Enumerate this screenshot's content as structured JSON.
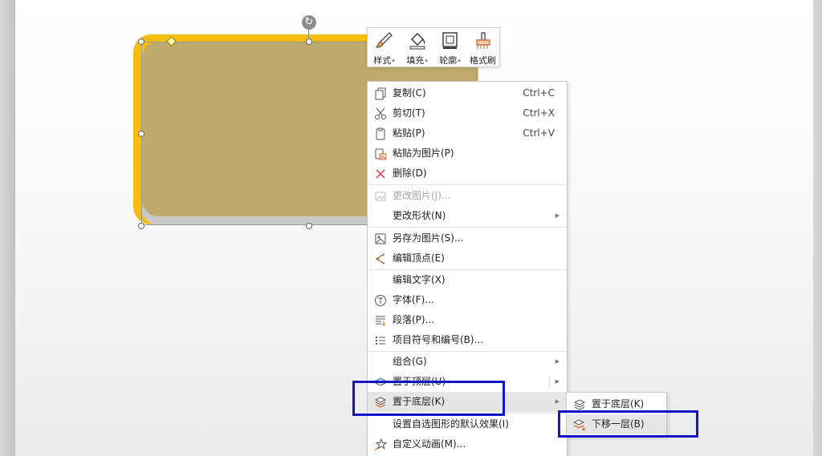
{
  "mini_toolbar": {
    "buttons": [
      {
        "label": "样式",
        "icon": "brush-icon",
        "has_dropdown": true
      },
      {
        "label": "填充",
        "icon": "fill-bucket-icon",
        "has_dropdown": true
      },
      {
        "label": "轮廓",
        "icon": "outline-icon",
        "has_dropdown": true
      },
      {
        "label": "格式刷",
        "icon": "format-painter-icon",
        "has_dropdown": false
      }
    ]
  },
  "context_menu": {
    "items": [
      {
        "label": "复制(C)",
        "shortcut": "Ctrl+C",
        "icon": "copy-icon"
      },
      {
        "label": "剪切(T)",
        "shortcut": "Ctrl+X",
        "icon": "scissors-icon"
      },
      {
        "label": "粘贴(P)",
        "shortcut": "Ctrl+V",
        "icon": "paste-icon"
      },
      {
        "label": "粘贴为图片(P)",
        "icon": "paste-image-icon"
      },
      {
        "label": "删除(D)",
        "icon": "delete-x-icon"
      },
      {
        "label": "更改图片(J)...",
        "icon": "change-picture-icon",
        "disabled": true
      },
      {
        "label": "更改形状(N)",
        "has_submenu": true
      },
      {
        "label": "另存为图片(S)...",
        "icon": "save-image-icon"
      },
      {
        "label": "编辑顶点(E)",
        "icon": "edit-points-icon"
      },
      {
        "label": "编辑文字(X)"
      },
      {
        "label": "字体(F)...",
        "icon": "font-icon"
      },
      {
        "label": "段落(P)...",
        "icon": "paragraph-icon"
      },
      {
        "label": "项目符号和编号(B)...",
        "icon": "bullet-list-icon"
      },
      {
        "label": "组合(G)",
        "has_submenu": true
      },
      {
        "label": "置于顶层(U)",
        "icon": "bring-to-front-icon",
        "has_submenu": true
      },
      {
        "label": "置于底层(K)",
        "icon": "send-to-back-icon",
        "has_submenu": true,
        "highlighted": true
      },
      {
        "label": "设置自选图形的默认效果(I)"
      },
      {
        "label": "自定义动画(M)...",
        "icon": "animation-star-icon"
      }
    ]
  },
  "submenu": {
    "items": [
      {
        "label": "置于底层(K)",
        "icon": "layers-icon"
      },
      {
        "label": "下移一层(B)",
        "icon": "send-backward-icon",
        "highlighted": true
      }
    ]
  },
  "colors": {
    "shape_fill": "#bfaa6e",
    "shape_border": "#f5bd12",
    "annotation": "#1515c8",
    "highlight": "#e6e6e6"
  }
}
